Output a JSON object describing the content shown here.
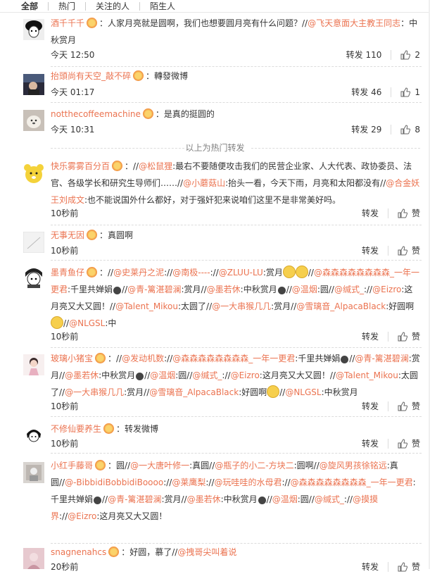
{
  "tabs": [
    "全部",
    "热门",
    "关注的人",
    "陌生人"
  ],
  "hot_divider": "以上为热门转发",
  "forward_label": "转发",
  "like_label": "赞",
  "comments": [
    {
      "user": "酒千千千",
      "segments": [
        {
          "t": "：人家月亮就是圆啊，我们也想要圆月亮有什么问题？//"
        },
        {
          "m": "@飞天意面大主教王同志"
        },
        {
          "t": "：中秋赏月"
        }
      ],
      "time": "今天 12:50",
      "forwards": "转发 110",
      "likes": "2"
    },
    {
      "user": "抬頭尚有天空_敲不碎",
      "segments": [
        {
          "t": "：轉發微博"
        }
      ],
      "time": "今天 01:17",
      "forwards": "转发 46",
      "likes": "1"
    },
    {
      "user": "notthecoffeemachine",
      "segments": [
        {
          "t": "：是真的挺圆的"
        }
      ],
      "time": "今天 10:31",
      "forwards": "转发 29",
      "likes": "8"
    },
    {
      "user": "快乐雾雾百分百",
      "segments": [
        {
          "t": "：//"
        },
        {
          "m": "@松鼠狸"
        },
        {
          "t": ":最右不要随便攻击我们的民营企业家、人大代表、政协委员、法官、各级学长和研究生导师们……//"
        },
        {
          "m": "@小蘑菇山"
        },
        {
          "t": ":抬头一看，今天下雨，月亮和太阳都没有//"
        },
        {
          "m": "@合金妖王刘成文"
        },
        {
          "t": ":也不能说国外什么都好，对于强奸犯来说咱们这里不是非常美好吗。"
        }
      ],
      "time": "10秒前"
    },
    {
      "user": "无事无因",
      "segments": [
        {
          "t": "：真圆啊"
        }
      ],
      "time": "10秒前"
    },
    {
      "user": "墨青鱼仔",
      "segments": [
        {
          "t": "：//"
        },
        {
          "m": "@史莱丹之泥"
        },
        {
          "t": "://"
        },
        {
          "m": "@南极----"
        },
        {
          "t": "://"
        },
        {
          "m": "@ZLUU-LU"
        },
        {
          "t": ":赏月"
        },
        {
          "e": "emo"
        },
        {
          "e": "emo"
        },
        {
          "t": "//"
        },
        {
          "m": "@森森森森森森森森_一年一更君"
        },
        {
          "t": ":千里共婵娟"
        },
        {
          "e": "sm"
        },
        {
          "t": "//"
        },
        {
          "m": "@青-篱湛碧澜"
        },
        {
          "t": ":赏月//"
        },
        {
          "m": "@墨若休"
        },
        {
          "t": ":中秋赏月"
        },
        {
          "e": "sm"
        },
        {
          "t": "//"
        },
        {
          "m": "@温烟"
        },
        {
          "t": ":圆//"
        },
        {
          "m": "@缄式_"
        },
        {
          "t": "://"
        },
        {
          "m": "@Eizro"
        },
        {
          "t": ":这月亮又大又圆！//"
        },
        {
          "m": "@Talent_Mikou"
        },
        {
          "t": ":太圆了//"
        },
        {
          "m": "@一大串猴几几"
        },
        {
          "t": ":赏月//"
        },
        {
          "m": "@雪璃音_AlpacaBlack"
        },
        {
          "t": ":好圆啊"
        },
        {
          "e": "emo"
        },
        {
          "t": "//"
        },
        {
          "m": "@NLGSL"
        },
        {
          "t": ":中"
        }
      ],
      "time": "10秒前"
    },
    {
      "user": "玻璃小猪宝",
      "segments": [
        {
          "t": "：//"
        },
        {
          "m": "@发动机数"
        },
        {
          "t": "://"
        },
        {
          "m": "@森森森森森森森森_一年一更君"
        },
        {
          "t": ":千里共婵娟"
        },
        {
          "e": "sm"
        },
        {
          "t": "//"
        },
        {
          "m": "@青-篱湛碧澜"
        },
        {
          "t": ":赏月//"
        },
        {
          "m": "@墨若休"
        },
        {
          "t": ":中秋赏月"
        },
        {
          "e": "sm"
        },
        {
          "t": "//"
        },
        {
          "m": "@温烟"
        },
        {
          "t": ":圆//"
        },
        {
          "m": "@缄式_"
        },
        {
          "t": "://"
        },
        {
          "m": "@Eizro"
        },
        {
          "t": ":这月亮又大又圆！//"
        },
        {
          "m": "@Talent_Mikou"
        },
        {
          "t": ":太圆了//"
        },
        {
          "m": "@一大串猴几几"
        },
        {
          "t": ":赏月//"
        },
        {
          "m": "@雪璃音_AlpacaBlack"
        },
        {
          "t": ":好圆啊"
        },
        {
          "e": "emo"
        },
        {
          "t": "//"
        },
        {
          "m": "@NLGSL"
        },
        {
          "t": ":中秋赏月"
        }
      ],
      "time": "10秒前"
    },
    {
      "user": "不修仙要养生",
      "segments": [
        {
          "t": "：转发微博"
        }
      ],
      "time": "10秒前"
    },
    {
      "user": "小红手藤哥",
      "segments": [
        {
          "t": "：圆//"
        },
        {
          "m": "@一大唐叶修一"
        },
        {
          "t": ":真圆//"
        },
        {
          "m": "@瓶子的小二-方块二"
        },
        {
          "t": ":圆啊//"
        },
        {
          "m": "@旋风男孩徐铭远"
        },
        {
          "t": ":真圆//"
        },
        {
          "m": "@-BibbidiBobbidiBoooo"
        },
        {
          "t": "://"
        },
        {
          "m": "@莱鹰梨"
        },
        {
          "t": "://"
        },
        {
          "m": "@玩哇哇的水母君"
        },
        {
          "t": "://"
        },
        {
          "m": "@森森森森森森森森_一年一更君"
        },
        {
          "t": ":千里共婵娟"
        },
        {
          "e": "sm"
        },
        {
          "t": "//"
        },
        {
          "m": "@青-篱湛碧澜"
        },
        {
          "t": ":赏月//"
        },
        {
          "m": "@墨若休"
        },
        {
          "t": ":中秋赏月"
        },
        {
          "e": "sm"
        },
        {
          "t": "//"
        },
        {
          "m": "@温烟"
        },
        {
          "t": ":圆//"
        },
        {
          "m": "@缄式_"
        },
        {
          "t": "://"
        },
        {
          "m": "@摸摸界"
        },
        {
          "t": "://"
        },
        {
          "m": "@Eizro"
        },
        {
          "t": ":这月亮又大又圆！"
        }
      ],
      "time": ""
    },
    {
      "user": "snagnenahcs",
      "segments": [
        {
          "t": "：好圆，慕了//"
        },
        {
          "m": "@拽哥尖叫着说"
        }
      ],
      "time": "20秒前"
    }
  ]
}
